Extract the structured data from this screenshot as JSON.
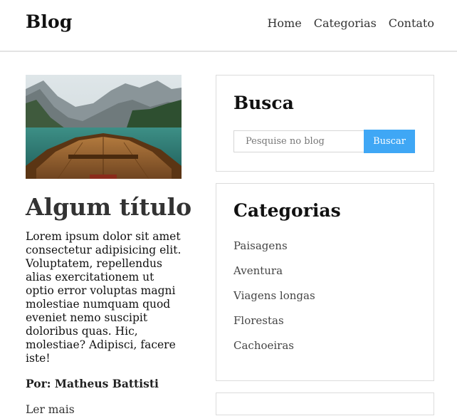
{
  "header": {
    "brand": "Blog",
    "nav": [
      {
        "label": "Home"
      },
      {
        "label": "Categorias"
      },
      {
        "label": "Contato"
      }
    ]
  },
  "post": {
    "title": "Algum título",
    "body": "Lorem ipsum dolor sit amet consectetur adipisicing elit. Voluptatem, repellendus alias exercitationem ut optio error voluptas magni molestiae numquam quod eveniet nemo suscipit doloribus quas. Hic, molestiae? Adipisci, facere iste!",
    "author": "Por: Matheus Battisti",
    "read_more": "Ler mais"
  },
  "search": {
    "title": "Busca",
    "placeholder": "Pesquise no blog",
    "button_label": "Buscar"
  },
  "categories": {
    "title": "Categorias",
    "items": [
      {
        "label": "Paisagens"
      },
      {
        "label": "Aventura"
      },
      {
        "label": "Viagens longas"
      },
      {
        "label": "Florestas"
      },
      {
        "label": "Cachoeiras"
      }
    ]
  }
}
